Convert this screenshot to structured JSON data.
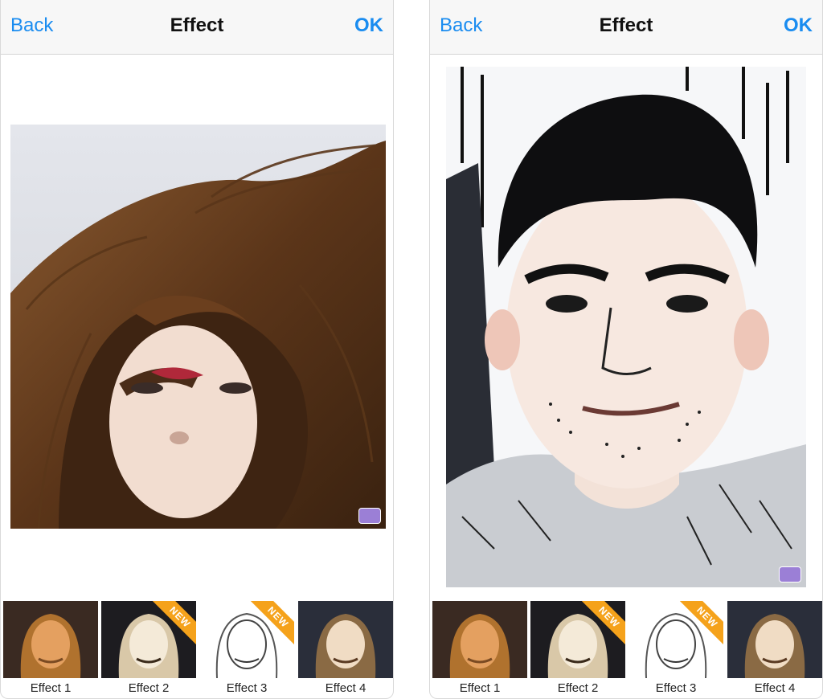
{
  "screens": [
    {
      "navbar": {
        "back_label": "Back",
        "title": "Effect",
        "ok_label": "OK"
      },
      "effects": [
        {
          "label": "Effect 1",
          "badge": ""
        },
        {
          "label": "Effect 2",
          "badge": "NEW"
        },
        {
          "label": "Effect 3",
          "badge": "NEW"
        },
        {
          "label": "Effect 4",
          "badge": ""
        }
      ]
    },
    {
      "navbar": {
        "back_label": "Back",
        "title": "Effect",
        "ok_label": "OK"
      },
      "effects": [
        {
          "label": "Effect 1",
          "badge": ""
        },
        {
          "label": "Effect 2",
          "badge": "NEW"
        },
        {
          "label": "Effect 3",
          "badge": "NEW"
        },
        {
          "label": "Effect 4",
          "badge": ""
        }
      ]
    }
  ],
  "colors": {
    "accent": "#1a8cf0",
    "badge": "#f5a21b",
    "navbar_bg": "#f7f7f7"
  }
}
